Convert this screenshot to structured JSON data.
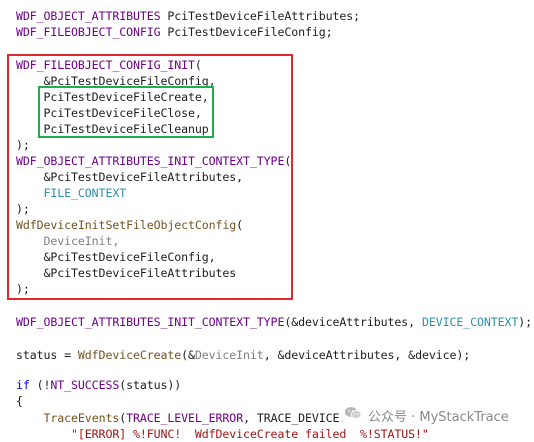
{
  "code": {
    "l1": {
      "a": "WDF_OBJECT_ATTRIBUTES",
      "b": " PciTestDeviceFileAttributes;"
    },
    "l2": {
      "a": "WDF_FILEOBJECT_CONFIG",
      "b": " PciTestDeviceFileConfig;"
    },
    "l3": {
      "a": "WDF_FILEOBJECT_CONFIG_INIT",
      "b": "("
    },
    "l4": "    &PciTestDeviceFileConfig,",
    "l5": "    PciTestDeviceFileCreate,",
    "l6": "    PciTestDeviceFileClose,",
    "l7": "    PciTestDeviceFileCleanup",
    "l8": ");",
    "l9": {
      "a": "WDF_OBJECT_ATTRIBUTES_INIT_CONTEXT_TYPE",
      "b": "("
    },
    "l10": "    &PciTestDeviceFileAttributes,",
    "l11": "    FILE_CONTEXT",
    "l12": ");",
    "l13": {
      "a": "WdfDeviceInitSetFileObjectConfig",
      "b": "("
    },
    "l14": "    DeviceInit,",
    "l15": "    &PciTestDeviceFileConfig,",
    "l16": "    &PciTestDeviceFileAttributes",
    "l17": ");",
    "l18": {
      "a": "WDF_OBJECT_ATTRIBUTES_INIT_CONTEXT_TYPE",
      "b": "(&deviceAttributes, ",
      "c": "DEVICE_CONTEXT",
      "d": ");"
    },
    "l19": {
      "a": "status = ",
      "b": "WdfDeviceCreate",
      "c": "(&",
      "d": "DeviceInit",
      "e": ", &deviceAttributes, &device);"
    },
    "l20": {
      "a": "if",
      "b": " (!",
      "c": "NT_SUCCESS",
      "d": "(status))"
    },
    "l21": "{",
    "l22": {
      "a": "    ",
      "b": "TraceEvents",
      "c": "(",
      "d": "TRACE_LEVEL_ERROR",
      "e": ", TRACE_DEVICE,"
    },
    "l23": "        \"[ERROR] %!FUNC!  WdfDeviceCreate failed  %!STATUS!\""
  },
  "watermark": {
    "text": "公众号 · MyStackTrace",
    "icon": "wechat-icon"
  },
  "colors": {
    "macro": "#6f008a",
    "type": "#2b91af",
    "function": "#74531f",
    "parameter": "#808080",
    "string": "#a31515",
    "keyword": "#0000ff",
    "highlight_outer": "#e0282e",
    "highlight_inner": "#1fae4b"
  }
}
